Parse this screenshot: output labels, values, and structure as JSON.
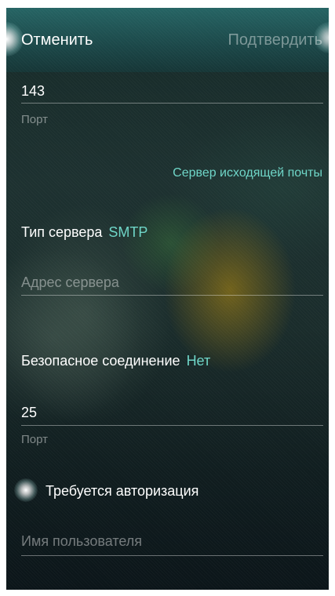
{
  "header": {
    "cancel_label": "Отменить",
    "confirm_label": "Подтвердить"
  },
  "incoming": {
    "port_value": "143",
    "port_hint": "Порт"
  },
  "outgoing": {
    "section_title": "Сервер исходящей почты",
    "server_type_label": "Тип сервера",
    "server_type_value": "SMTP",
    "server_address_placeholder": "Адрес сервера",
    "secure_connection_label": "Безопасное соединение",
    "secure_connection_value": "Нет",
    "port_value": "25",
    "port_hint": "Порт",
    "auth_required_label": "Требуется авторизация",
    "username_placeholder": "Имя пользователя"
  },
  "colors": {
    "accent": "#6fd6c8",
    "header_bg": "#1f5c5e"
  }
}
